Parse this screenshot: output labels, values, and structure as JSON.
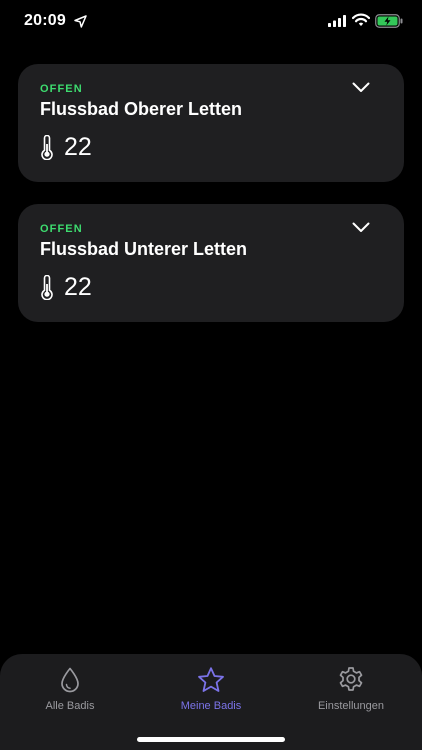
{
  "status_bar": {
    "time": "20:09",
    "icons": [
      "location-arrow-icon",
      "cellular-signal-icon",
      "wifi-icon",
      "battery-charging-icon"
    ]
  },
  "cards": [
    {
      "status": "OFFEN",
      "title": "Flussbad Oberer Letten",
      "temperature": "22"
    },
    {
      "status": "OFFEN",
      "title": "Flussbad Unterer Letten",
      "temperature": "22"
    }
  ],
  "tab_bar": {
    "tabs": [
      {
        "label": "Alle Badis",
        "icon": "water-drop-icon",
        "active": false
      },
      {
        "label": "Meine Badis",
        "icon": "star-icon",
        "active": true
      },
      {
        "label": "Einstellungen",
        "icon": "gear-icon",
        "active": false
      }
    ]
  },
  "colors": {
    "background": "#000000",
    "card": "#1f1f21",
    "status_open": "#3ddc6f",
    "accent": "#7b73e8",
    "tab_inactive": "#9a9a9f"
  }
}
